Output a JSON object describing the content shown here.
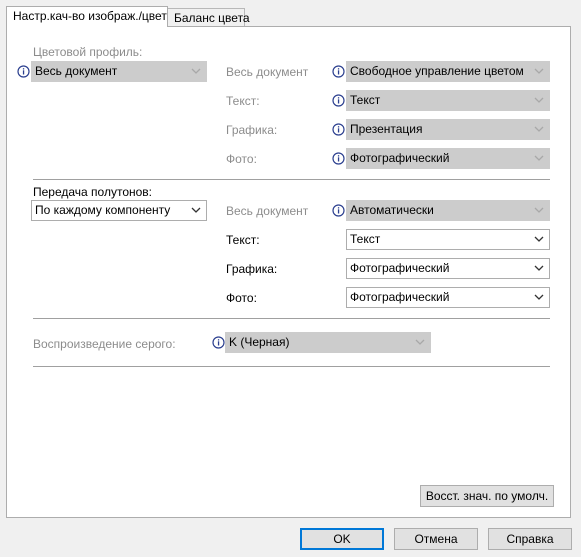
{
  "tabs": [
    {
      "label": "Настр.кач-во изображ./цвет"
    },
    {
      "label": "Баланс цвета"
    }
  ],
  "color_profile": {
    "label": "Цветовой профиль:",
    "value": "Весь документ",
    "rows": [
      {
        "label": "Весь документ",
        "value": "Свободное управление цветом"
      },
      {
        "label": "Текст:",
        "value": "Текст"
      },
      {
        "label": "Графика:",
        "value": "Презентация"
      },
      {
        "label": "Фото:",
        "value": "Фотографический"
      }
    ]
  },
  "halftone": {
    "label": "Передача полутонов:",
    "value": "По каждому компоненту",
    "rows": [
      {
        "label": "Весь документ",
        "value": "Автоматически"
      },
      {
        "label": "Текст:",
        "value": "Текст"
      },
      {
        "label": "Графика:",
        "value": "Фотографический"
      },
      {
        "label": "Фото:",
        "value": "Фотографический"
      }
    ]
  },
  "gray": {
    "label": "Воспроизведение серого:",
    "value": "K (Черная)"
  },
  "buttons": {
    "restore": "Восст. знач. по умолч.",
    "ok": "OK",
    "cancel": "Отмена",
    "help": "Справка"
  },
  "colors": {
    "disabled_text": "#8c8c8c",
    "disabled_field": "#cccccc",
    "info_icon": "#2b3f8f",
    "default_button_border": "#0078d7"
  }
}
